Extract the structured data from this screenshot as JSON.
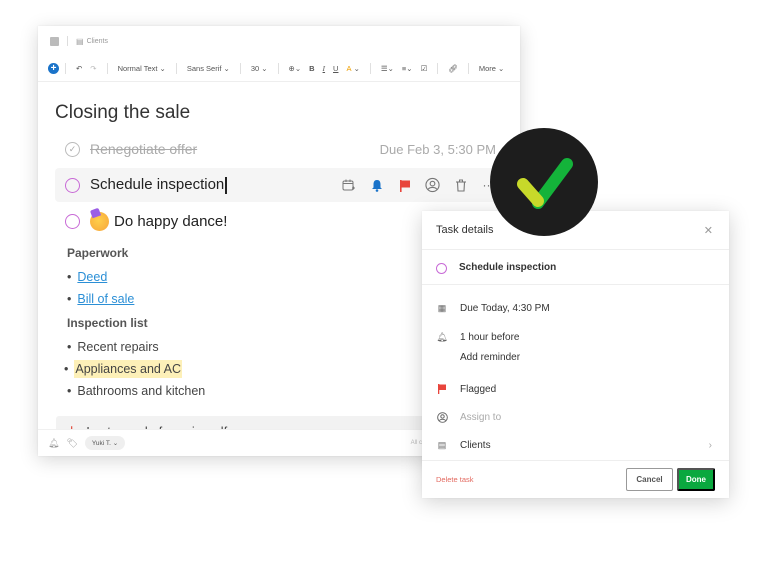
{
  "editor": {
    "breadcrumb": "Clients",
    "toolbar": {
      "style_label": "Normal Text",
      "font_label": "Sans Serif",
      "size_label": "30",
      "bold": "B",
      "italic": "I",
      "underline": "U",
      "highlight": "A",
      "more_label": "More"
    },
    "title": "Closing the sale",
    "tasks": [
      {
        "label": "Renegotiate offer",
        "due": "Due Feb 3, 5:30 PM",
        "completed": true
      },
      {
        "label": "Schedule inspection",
        "completed": false
      },
      {
        "label": "Do happy dance!",
        "completed": false
      }
    ],
    "sections": [
      {
        "heading": "Paperwork",
        "items": [
          "Deed",
          "Bill of sale"
        ]
      },
      {
        "heading": "Inspection list",
        "items": [
          "Recent repairs",
          "Appliances and AC",
          "Bathrooms and kitchen"
        ]
      }
    ],
    "attachment": "Last round of repairs.pdf",
    "footer": {
      "user": "Yuki T.",
      "status": "All chan"
    }
  },
  "task_details": {
    "title": "Task details",
    "task_name": "Schedule inspection",
    "due": "Due Today, 4:30 PM",
    "reminder": "1 hour before",
    "add_reminder": "Add reminder",
    "flag": "Flagged",
    "assign_placeholder": "Assign to",
    "notebook": "Clients",
    "delete_label": "Delete task",
    "cancel_label": "Cancel",
    "done_label": "Done"
  },
  "colors": {
    "accent_blue": "#1a73c9",
    "task_circle": "#c86ad6",
    "flag_red": "#e8453c",
    "done_green": "#0aa83f",
    "link_blue": "#2b8fd6",
    "highlight": "#fdf0b8"
  }
}
